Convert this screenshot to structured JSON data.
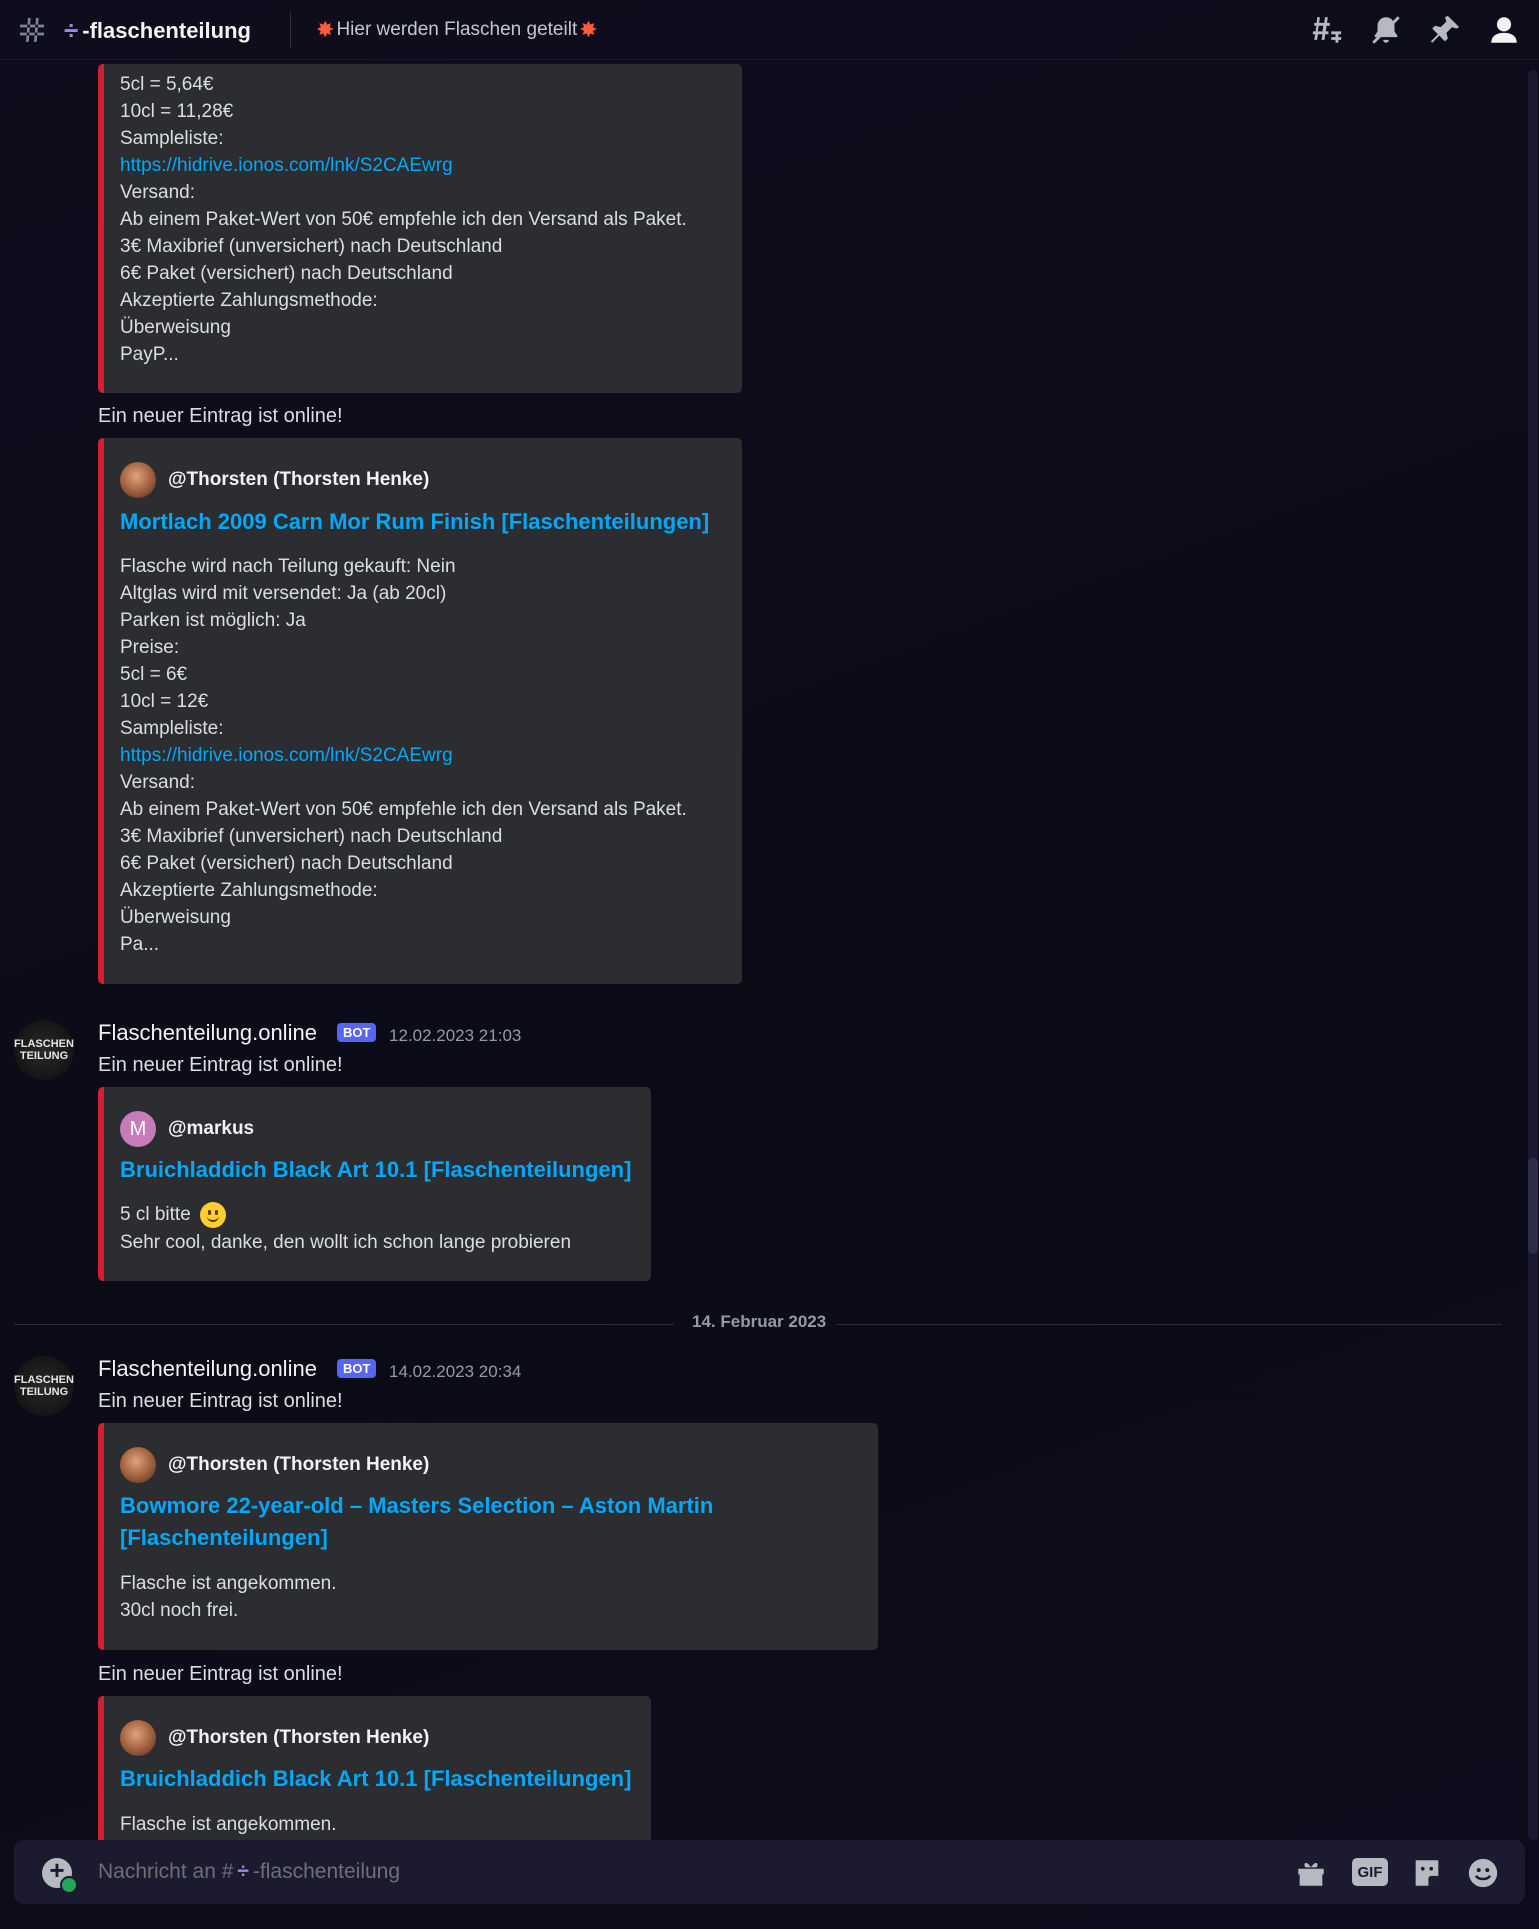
{
  "header": {
    "channel_name": "-flaschenteilung",
    "channel_prefix": "÷",
    "topic": "Hier werden Flaschen geteilt",
    "icons": [
      "threads-icon",
      "notification-muted-icon",
      "pin-icon",
      "member-list-icon"
    ]
  },
  "messages": {
    "m0": {
      "embed_lines": [
        "5cl = 5,64€",
        "10cl = 11,28€",
        "Sampleliste:",
        "https://hidrive.ionos.com/lnk/S2CAEwrg",
        "Versand:",
        "Ab einem Paket-Wert von 50€ empfehle ich den Versand als Paket.",
        "3€ Maxibrief (unversichert) nach Deutschland",
        "6€ Paket (versichert) nach Deutschland",
        "Akzeptierte Zahlungsmethode:",
        "Überweisung",
        "PayP..."
      ]
    },
    "m1": {
      "text": "Ein neuer Eintrag ist online!",
      "author": "@Thorsten (Thorsten Henke)",
      "title": "Mortlach 2009 Carn Mor Rum Finish [Flaschenteilungen]",
      "embed_lines": [
        "Flasche wird nach Teilung gekauft: Nein",
        "Altglas wird mit versendet: Ja (ab 20cl)",
        "Parken ist möglich: Ja",
        "Preise:",
        "5cl = 6€",
        "10cl = 12€",
        "Sampleliste:",
        "https://hidrive.ionos.com/lnk/S2CAEwrg",
        "Versand:",
        "Ab einem Paket-Wert von 50€ empfehle ich den Versand als Paket.",
        "3€ Maxibrief (unversichert) nach Deutschland",
        "6€ Paket (versichert) nach Deutschland",
        "Akzeptierte Zahlungsmethode:",
        "Überweisung",
        "Pa..."
      ]
    },
    "m2": {
      "username": "Flaschenteilung.online",
      "badge": "BOT",
      "timestamp": "12.02.2023 21:03",
      "text": "Ein neuer Eintrag ist online!",
      "author": "@markus",
      "author_initial": "M",
      "title": "Bruichladdich Black Art 10.1 [Flaschenteilungen]",
      "embed_lines": [
        "5 cl bitte",
        "Sehr cool, danke, den wollt ich schon lange probieren"
      ]
    },
    "date_separator": "14. Februar 2023",
    "m3": {
      "username": "Flaschenteilung.online",
      "badge": "BOT",
      "timestamp": "14.02.2023 20:34",
      "text": "Ein neuer Eintrag ist online!",
      "author": "@Thorsten (Thorsten Henke)",
      "title": "Bowmore 22-year-old – Masters Selection – Aston Martin [Flaschenteilungen]",
      "embed_lines": [
        "Flasche ist angekommen.",
        "30cl noch frei."
      ]
    },
    "m4": {
      "text": "Ein neuer Eintrag ist online!",
      "author": "@Thorsten (Thorsten Henke)",
      "title": "Bruichladdich Black Art 10.1 [Flaschenteilungen]",
      "embed_lines": [
        "Flasche ist angekommen."
      ]
    },
    "bot_avatar_lines": [
      "FLASCHEN",
      "TEILUNG"
    ]
  },
  "composer": {
    "placeholder_prefix": "Nachricht an #",
    "placeholder_channel": "-flaschenteilung",
    "gif_label": "GIF"
  },
  "colors": {
    "embed_accent": "#d4202e",
    "link": "#00a8fc",
    "bot_badge": "#5865f2",
    "background": "#0e0d1d"
  }
}
